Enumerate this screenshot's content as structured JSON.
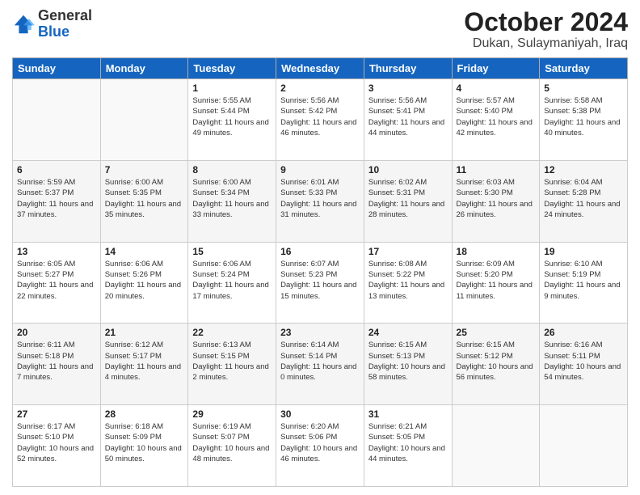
{
  "header": {
    "logo_general": "General",
    "logo_blue": "Blue",
    "title": "October 2024",
    "subtitle": "Dukan, Sulaymaniyah, Iraq"
  },
  "weekdays": [
    "Sunday",
    "Monday",
    "Tuesday",
    "Wednesday",
    "Thursday",
    "Friday",
    "Saturday"
  ],
  "weeks": [
    [
      {
        "day": "",
        "sunrise": "",
        "sunset": "",
        "daylight": ""
      },
      {
        "day": "",
        "sunrise": "",
        "sunset": "",
        "daylight": ""
      },
      {
        "day": "1",
        "sunrise": "Sunrise: 5:55 AM",
        "sunset": "Sunset: 5:44 PM",
        "daylight": "Daylight: 11 hours and 49 minutes."
      },
      {
        "day": "2",
        "sunrise": "Sunrise: 5:56 AM",
        "sunset": "Sunset: 5:42 PM",
        "daylight": "Daylight: 11 hours and 46 minutes."
      },
      {
        "day": "3",
        "sunrise": "Sunrise: 5:56 AM",
        "sunset": "Sunset: 5:41 PM",
        "daylight": "Daylight: 11 hours and 44 minutes."
      },
      {
        "day": "4",
        "sunrise": "Sunrise: 5:57 AM",
        "sunset": "Sunset: 5:40 PM",
        "daylight": "Daylight: 11 hours and 42 minutes."
      },
      {
        "day": "5",
        "sunrise": "Sunrise: 5:58 AM",
        "sunset": "Sunset: 5:38 PM",
        "daylight": "Daylight: 11 hours and 40 minutes."
      }
    ],
    [
      {
        "day": "6",
        "sunrise": "Sunrise: 5:59 AM",
        "sunset": "Sunset: 5:37 PM",
        "daylight": "Daylight: 11 hours and 37 minutes."
      },
      {
        "day": "7",
        "sunrise": "Sunrise: 6:00 AM",
        "sunset": "Sunset: 5:35 PM",
        "daylight": "Daylight: 11 hours and 35 minutes."
      },
      {
        "day": "8",
        "sunrise": "Sunrise: 6:00 AM",
        "sunset": "Sunset: 5:34 PM",
        "daylight": "Daylight: 11 hours and 33 minutes."
      },
      {
        "day": "9",
        "sunrise": "Sunrise: 6:01 AM",
        "sunset": "Sunset: 5:33 PM",
        "daylight": "Daylight: 11 hours and 31 minutes."
      },
      {
        "day": "10",
        "sunrise": "Sunrise: 6:02 AM",
        "sunset": "Sunset: 5:31 PM",
        "daylight": "Daylight: 11 hours and 28 minutes."
      },
      {
        "day": "11",
        "sunrise": "Sunrise: 6:03 AM",
        "sunset": "Sunset: 5:30 PM",
        "daylight": "Daylight: 11 hours and 26 minutes."
      },
      {
        "day": "12",
        "sunrise": "Sunrise: 6:04 AM",
        "sunset": "Sunset: 5:28 PM",
        "daylight": "Daylight: 11 hours and 24 minutes."
      }
    ],
    [
      {
        "day": "13",
        "sunrise": "Sunrise: 6:05 AM",
        "sunset": "Sunset: 5:27 PM",
        "daylight": "Daylight: 11 hours and 22 minutes."
      },
      {
        "day": "14",
        "sunrise": "Sunrise: 6:06 AM",
        "sunset": "Sunset: 5:26 PM",
        "daylight": "Daylight: 11 hours and 20 minutes."
      },
      {
        "day": "15",
        "sunrise": "Sunrise: 6:06 AM",
        "sunset": "Sunset: 5:24 PM",
        "daylight": "Daylight: 11 hours and 17 minutes."
      },
      {
        "day": "16",
        "sunrise": "Sunrise: 6:07 AM",
        "sunset": "Sunset: 5:23 PM",
        "daylight": "Daylight: 11 hours and 15 minutes."
      },
      {
        "day": "17",
        "sunrise": "Sunrise: 6:08 AM",
        "sunset": "Sunset: 5:22 PM",
        "daylight": "Daylight: 11 hours and 13 minutes."
      },
      {
        "day": "18",
        "sunrise": "Sunrise: 6:09 AM",
        "sunset": "Sunset: 5:20 PM",
        "daylight": "Daylight: 11 hours and 11 minutes."
      },
      {
        "day": "19",
        "sunrise": "Sunrise: 6:10 AM",
        "sunset": "Sunset: 5:19 PM",
        "daylight": "Daylight: 11 hours and 9 minutes."
      }
    ],
    [
      {
        "day": "20",
        "sunrise": "Sunrise: 6:11 AM",
        "sunset": "Sunset: 5:18 PM",
        "daylight": "Daylight: 11 hours and 7 minutes."
      },
      {
        "day": "21",
        "sunrise": "Sunrise: 6:12 AM",
        "sunset": "Sunset: 5:17 PM",
        "daylight": "Daylight: 11 hours and 4 minutes."
      },
      {
        "day": "22",
        "sunrise": "Sunrise: 6:13 AM",
        "sunset": "Sunset: 5:15 PM",
        "daylight": "Daylight: 11 hours and 2 minutes."
      },
      {
        "day": "23",
        "sunrise": "Sunrise: 6:14 AM",
        "sunset": "Sunset: 5:14 PM",
        "daylight": "Daylight: 11 hours and 0 minutes."
      },
      {
        "day": "24",
        "sunrise": "Sunrise: 6:15 AM",
        "sunset": "Sunset: 5:13 PM",
        "daylight": "Daylight: 10 hours and 58 minutes."
      },
      {
        "day": "25",
        "sunrise": "Sunrise: 6:15 AM",
        "sunset": "Sunset: 5:12 PM",
        "daylight": "Daylight: 10 hours and 56 minutes."
      },
      {
        "day": "26",
        "sunrise": "Sunrise: 6:16 AM",
        "sunset": "Sunset: 5:11 PM",
        "daylight": "Daylight: 10 hours and 54 minutes."
      }
    ],
    [
      {
        "day": "27",
        "sunrise": "Sunrise: 6:17 AM",
        "sunset": "Sunset: 5:10 PM",
        "daylight": "Daylight: 10 hours and 52 minutes."
      },
      {
        "day": "28",
        "sunrise": "Sunrise: 6:18 AM",
        "sunset": "Sunset: 5:09 PM",
        "daylight": "Daylight: 10 hours and 50 minutes."
      },
      {
        "day": "29",
        "sunrise": "Sunrise: 6:19 AM",
        "sunset": "Sunset: 5:07 PM",
        "daylight": "Daylight: 10 hours and 48 minutes."
      },
      {
        "day": "30",
        "sunrise": "Sunrise: 6:20 AM",
        "sunset": "Sunset: 5:06 PM",
        "daylight": "Daylight: 10 hours and 46 minutes."
      },
      {
        "day": "31",
        "sunrise": "Sunrise: 6:21 AM",
        "sunset": "Sunset: 5:05 PM",
        "daylight": "Daylight: 10 hours and 44 minutes."
      },
      {
        "day": "",
        "sunrise": "",
        "sunset": "",
        "daylight": ""
      },
      {
        "day": "",
        "sunrise": "",
        "sunset": "",
        "daylight": ""
      }
    ]
  ]
}
